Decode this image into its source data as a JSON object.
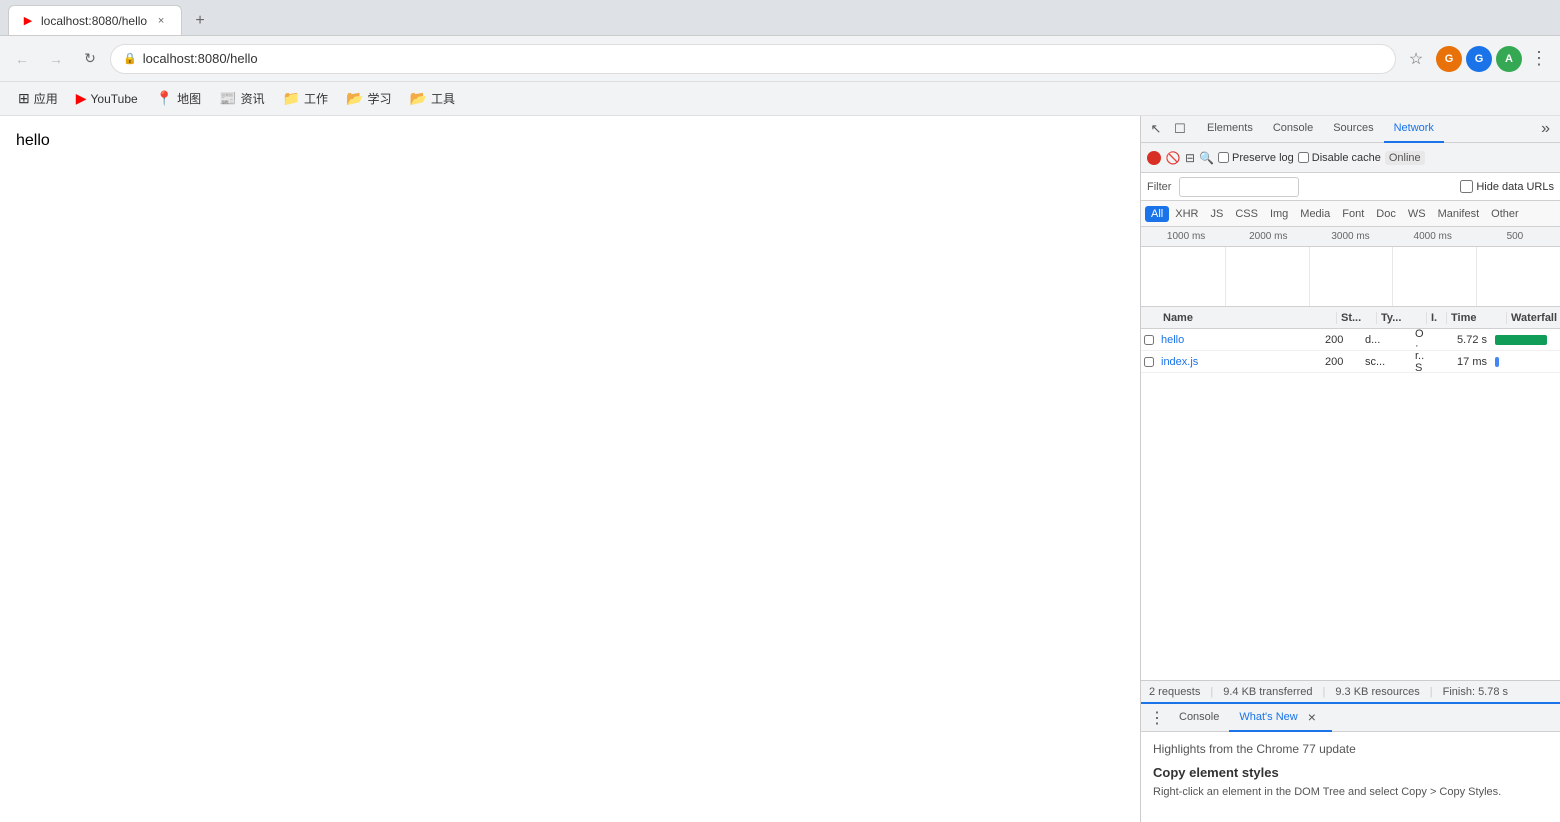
{
  "browser": {
    "tab_title": "localhost:8080/hello",
    "tab_youtube": "YouTube",
    "address": "localhost:8080/hello",
    "new_tab_label": "+",
    "close_label": "×"
  },
  "bookmarks": [
    {
      "id": "apps",
      "icon": "⊞",
      "label": "应用"
    },
    {
      "id": "youtube",
      "icon": "▶",
      "label": "YouTube"
    },
    {
      "id": "map",
      "icon": "📍",
      "label": "地图"
    },
    {
      "id": "news",
      "icon": "📰",
      "label": "资讯"
    },
    {
      "id": "work",
      "icon": "📁",
      "label": "工作"
    },
    {
      "id": "study",
      "icon": "📂",
      "label": "学习"
    },
    {
      "id": "tools",
      "icon": "📂",
      "label": "工具"
    }
  ],
  "page": {
    "hello_text": "hello"
  },
  "devtools": {
    "tabs": [
      {
        "id": "elements",
        "label": "Elements"
      },
      {
        "id": "console",
        "label": "Console"
      },
      {
        "id": "sources",
        "label": "Sources"
      },
      {
        "id": "network",
        "label": "Network"
      }
    ],
    "more_label": "»",
    "active_tab": "network",
    "network": {
      "preserve_log_label": "Preserve log",
      "disable_cache_label": "Disable cache",
      "online_label": "Online",
      "filter_label": "Filter",
      "hide_data_label": "Hide data URLs",
      "type_filters": [
        "All",
        "XHR",
        "JS",
        "CSS",
        "Img",
        "Media",
        "Font",
        "Doc",
        "WS",
        "Manifest",
        "Other"
      ],
      "active_type_filter": "All",
      "timeline_ticks": [
        "1000 ms",
        "2000 ms",
        "3000 ms",
        "4000 ms",
        "500"
      ],
      "columns": {
        "name": "Name",
        "status": "St...",
        "type": "Ty...",
        "initiator": "I.",
        "time": "Time",
        "waterfall": "Waterfall"
      },
      "rows": [
        {
          "id": "hello",
          "name": "hello",
          "status": "200",
          "type": "d...",
          "initiator": "O",
          "initiator2": "·",
          "time": "5.72 s",
          "waterfall_color": "green",
          "waterfall_width": 85,
          "waterfall_offset": 0
        },
        {
          "id": "index.js",
          "name": "index.js",
          "status": "200",
          "type": "sc...",
          "initiator": "r..",
          "initiator2": "S",
          "time": "17 ms",
          "waterfall_color": "blue",
          "waterfall_width": 6,
          "waterfall_offset": 0
        }
      ],
      "status_bar": {
        "requests": "2 requests",
        "transferred": "9.4 KB transferred",
        "resources": "9.3 KB resources",
        "finish": "Finish: 5.78 s"
      }
    },
    "drawer": {
      "tabs": [
        {
          "id": "console",
          "label": "Console"
        },
        {
          "id": "whats-new",
          "label": "What's New"
        }
      ],
      "active_tab": "whats-new",
      "content_title": "Highlights from the Chrome 77 update",
      "feature_title": "Copy element styles",
      "feature_desc": "Right-click an element in the DOM Tree and select Copy > Copy Styles."
    }
  },
  "icons": {
    "back": "←",
    "forward": "→",
    "reload": "↻",
    "lock": "🔒",
    "star": "☆",
    "menu": "⋮",
    "record": "●",
    "clear": "🚫",
    "filter": "⊟",
    "search": "🔍",
    "inspect": "↖",
    "device": "☐",
    "three_dots": "⋮"
  }
}
